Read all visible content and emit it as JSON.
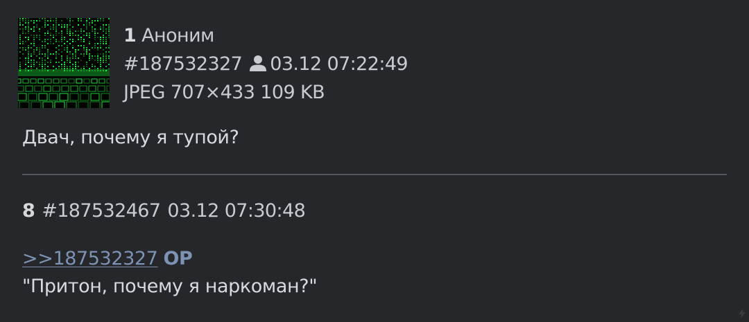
{
  "op_post": {
    "number": "1",
    "author": "Аноним",
    "post_id": "#187532327",
    "icon": "person-icon",
    "timestamp": "03.12 07:22:49",
    "file_info": "JPEG 707×433 109 KB",
    "thumbnail_icon": "matrix-keyboard-thumbnail",
    "text": "Двач, почему я тупой?"
  },
  "reply": {
    "number": "8",
    "post_id": "#187532467",
    "timestamp": "03.12 07:30:48",
    "quote_link": ">>187532327",
    "op_badge": "OP",
    "text": "\"Притон, почему я наркоман?\""
  },
  "colors": {
    "background": "#26272b",
    "text": "#cfd1d6",
    "link": "#7d93b4",
    "divider": "#55575d",
    "thumbnail_accent": "#22ff44"
  }
}
